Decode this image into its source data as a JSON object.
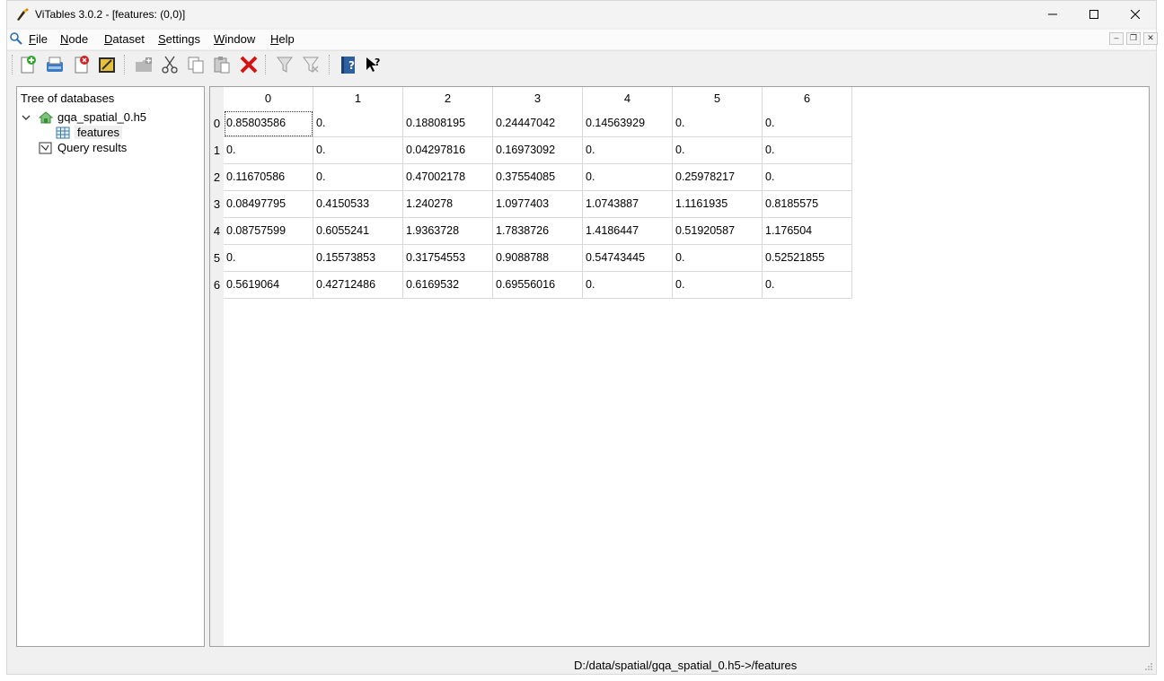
{
  "window": {
    "title": "ViTables 3.0.2 - [features: (0,0)]"
  },
  "menu": {
    "items": [
      "File",
      "Node",
      "Dataset",
      "Settings",
      "Window",
      "Help"
    ]
  },
  "toolbar": {
    "buttons": [
      {
        "name": "new-file-icon"
      },
      {
        "name": "open-file-icon"
      },
      {
        "name": "close-file-icon"
      },
      {
        "name": "save-as-icon"
      },
      {
        "name": "new-group-icon"
      },
      {
        "name": "cut-icon"
      },
      {
        "name": "copy-icon"
      },
      {
        "name": "paste-icon"
      },
      {
        "name": "delete-icon"
      },
      {
        "name": "query-icon"
      },
      {
        "name": "delete-queries-icon"
      },
      {
        "name": "users-guide-icon"
      },
      {
        "name": "whats-this-icon"
      }
    ]
  },
  "tree": {
    "header": "Tree of databases",
    "file": "gqa_spatial_0.h5",
    "dataset": "features",
    "query_results": "Query results"
  },
  "table": {
    "columns": [
      "0",
      "1",
      "2",
      "3",
      "4",
      "5",
      "6"
    ],
    "row_headers": [
      "0",
      "1",
      "2",
      "3",
      "4",
      "5",
      "6"
    ],
    "rows": [
      [
        "0.85803586",
        "0.",
        "0.18808195",
        "0.24447042",
        "0.14563929",
        "0.",
        "0."
      ],
      [
        "0.",
        "0.",
        "0.04297816",
        "0.16973092",
        "0.",
        "0.",
        "0."
      ],
      [
        "0.11670586",
        "0.",
        "0.47002178",
        "0.37554085",
        "0.",
        "0.25978217",
        "0."
      ],
      [
        "0.08497795",
        "0.4150533",
        "1.240278",
        "1.0977403",
        "1.0743887",
        "1.1161935",
        "0.8185575"
      ],
      [
        "0.08757599",
        "0.6055241",
        "1.9363728",
        "1.7838726",
        "1.4186447",
        "0.51920587",
        "1.176504"
      ],
      [
        "0.",
        "0.15573853",
        "0.31754553",
        "0.9088788",
        "0.54743445",
        "0.",
        "0.52521855"
      ],
      [
        "0.5619064",
        "0.42712486",
        "0.6169532",
        "0.69556016",
        "0.",
        "0.",
        "0."
      ]
    ]
  },
  "status": {
    "path": "D:/data/spatial/gqa_spatial_0.h5->/features"
  }
}
